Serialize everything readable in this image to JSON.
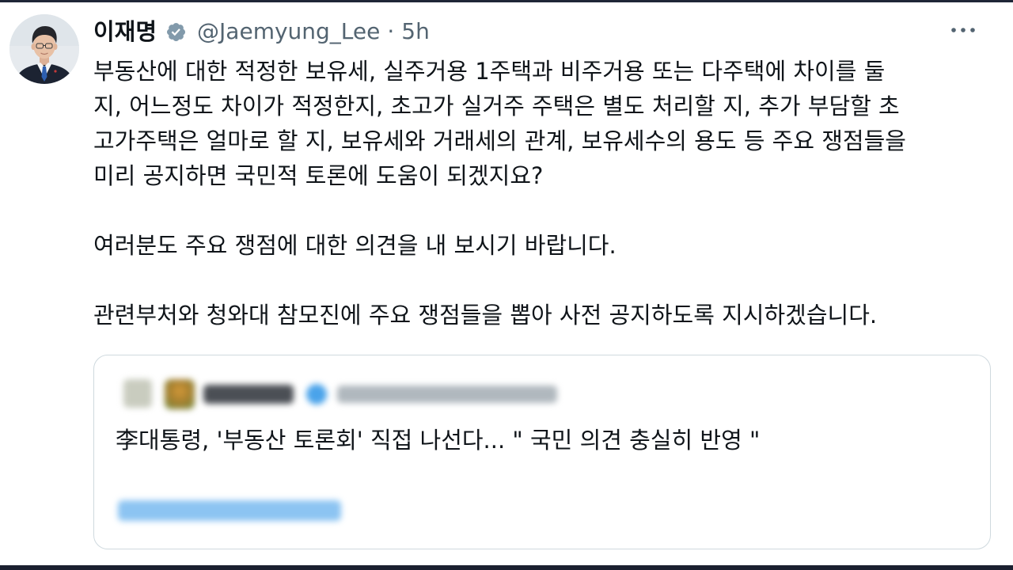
{
  "tweet": {
    "author": {
      "name": "이재명",
      "handle": "@Jaemyung_Lee",
      "separator": "·",
      "time": "5h",
      "verified_badge_icon": "verified-badge-icon",
      "avatar_icon": "profile-photo"
    },
    "more_icon": "more-horizontal-icon",
    "paragraphs": [
      [
        "부동산에 대한 적정한 보유세, 실주거용 1주택과 비주거용 또는 다주택에 차이를 둘",
        "지, 어느정도 차이가 적정한지, 초고가 실거주 주택은 별도 처리할 지, 추가 부담할 초",
        "고가주택은 얼마로 할 지, 보유세와 거래세의 관계, 보유세수의 용도 등 주요 쟁점들을",
        "미리 공지하면 국민적 토론에 도움이 되겠지요?"
      ],
      [
        "여러분도 주요 쟁점에 대한 의견을 내 보시기 바랍니다."
      ],
      [
        "관련부처와 청와대 참모진에 주요 쟁점들을 뽑아 사전 공지하도록 지시하겠습니다."
      ]
    ]
  },
  "quoted_tweet": {
    "text": "李대통령, '부동산 토론회' 직접 나선다... \" 국민 의견 충실히 반영 \""
  },
  "colors": {
    "text_primary": "#0f1419",
    "text_secondary": "#536471",
    "verified_badge": "#829aab",
    "card_border": "#cfd9de",
    "link": "#1d9bf0"
  }
}
